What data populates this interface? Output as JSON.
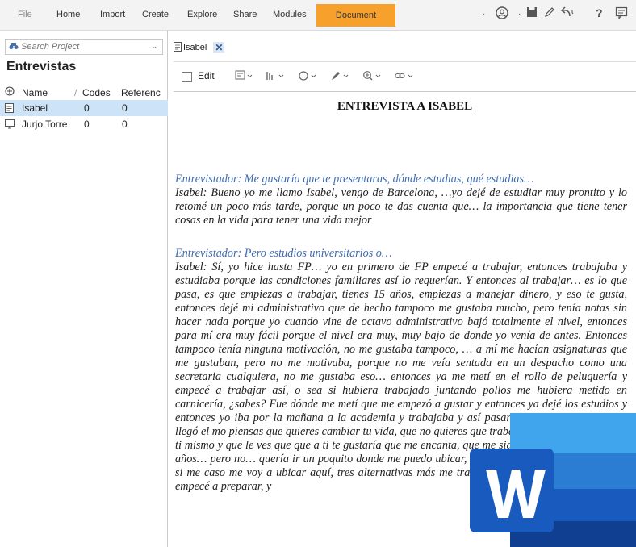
{
  "ribbon": {
    "menu": [
      "File",
      "Home",
      "Import",
      "Create",
      "Explore",
      "Share",
      "Modules"
    ],
    "active_tab": "Document"
  },
  "left_panel": {
    "search_placeholder": "Search Project",
    "title": "Entrevistas",
    "columns": [
      "Name",
      "Codes",
      "Referenc"
    ],
    "rows": [
      {
        "name": "Isabel",
        "codes": "0",
        "refs": "0"
      },
      {
        "name": "Jurjo Torre",
        "codes": "0",
        "refs": "0"
      }
    ]
  },
  "document": {
    "tab_label": "Isabel",
    "toolbar": {
      "edit_label": "Edit"
    },
    "heading": "ENTREVISTA A ISABEL",
    "paragraphs": [
      {
        "interviewer": "Entrevistador: Me gustaría que te presentaras, dónde estudias, qué estudias…",
        "answer": "Isabel: Bueno yo me llamo Isabel, vengo de Barcelona, …yo dejé de estudiar muy prontito y lo retomé un poco más tarde, porque un poco te das cuenta que… la importancia que tiene tener cosas en la vida para tener una vida mejor"
      },
      {
        "interviewer": "Entrevistador: Pero estudios universitarios o…",
        "answer": "Isabel: Sí, yo hice hasta FP… yo en primero de FP empecé a trabajar, entonces trabajaba y estudiaba porque las condiciones familiares así lo requerían. Y entonces al trabajar… es lo que pasa, es que empiezas a trabajar, tienes 15 años, empiezas a manejar dinero, y eso te gusta, entonces dejé mi administrativo que de hecho tampoco me gustaba mucho, pero tenía notas sin hacer nada porque yo cuando vine de octavo administrativo bajó totalmente el nivel, entonces para mí era muy fácil porque el nivel era muy, muy bajo de donde yo venía de antes. Entonces tampoco tenía ninguna motivación, no me gustaba tampoco, … a mí me hacían asignaturas que me gustaban, pero no me motivaba, porque no me veía sentada en un despacho como una secretaria cualquiera, no me gustaba eso… entonces ya me metí en el rollo de peluquería y empecé a trabajar así, o sea si hubiera trabajado juntando pollos me hubiera metido en carnicería, ¿sabes? Fue dónde me metí que me empezó a gustar y entonces ya dejé los estudios y entonces yo iba por la mañana a la academia y trabajaba y así pasaron años y años y años y llegó el mo piensas que quieres cambiar tu vida, que no quieres que trabajando para otros ni para ti mismo y que le ves que que a ti te gustaría que me encanta, que me sigue enca profesión por 10 años… pero no… quería ir un poquito donde me puedo ubicar, sabes, que ahora yo me quiero ub si me caso me voy a ubicar aquí, tres alternativas más me trabajar, estaba muy agobiada y me empecé a preparar, y"
      }
    ]
  },
  "colors": {
    "accent": "#f7a12c",
    "selection": "#cde3f7",
    "interviewer_text": "#3e6ab0",
    "word_blue": "#185abd"
  }
}
